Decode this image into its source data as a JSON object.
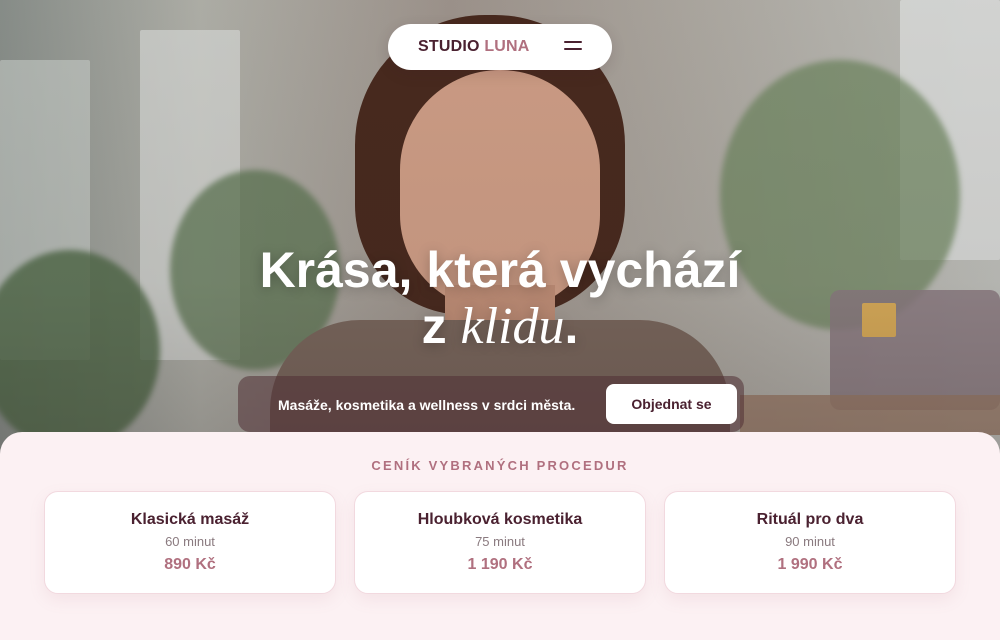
{
  "nav": {
    "brand_primary": "STUDIO",
    "brand_accent": "LUNA",
    "menu_icon": "hamburger-menu-icon"
  },
  "hero": {
    "headline_line1": "Krása, která vychází",
    "headline_line2_prefix": "z ",
    "headline_line2_italic": "klidu",
    "headline_line2_suffix": ".",
    "subtitle": "Masáže, kosmetika a wellness v srdci města.",
    "cta_label": "Objednat se"
  },
  "pricing": {
    "title": "CENÍK VYBRANÝCH PROCEDUR",
    "items": [
      {
        "name": "Klasická masáž",
        "duration": "60 minut",
        "price": "890 Kč"
      },
      {
        "name": "Hloubková kosmetika",
        "duration": "75 minut",
        "price": "1 190 Kč"
      },
      {
        "name": "Rituál pro dva",
        "duration": "90 minut",
        "price": "1 990 Kč"
      }
    ]
  },
  "colors": {
    "brand_dark": "#4a2130",
    "brand_accent": "#b0707f",
    "section_bg": "#fcf1f3"
  }
}
